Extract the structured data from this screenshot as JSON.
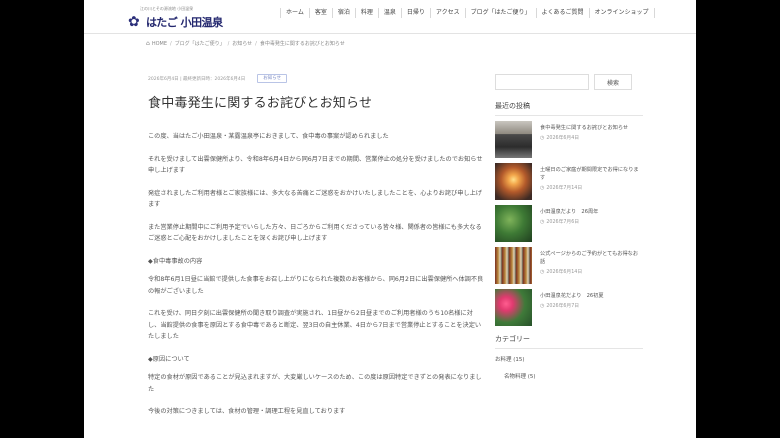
{
  "header": {
    "tagline": "江の川とその源流地 小田温泉",
    "logo_text": "はたご 小田温泉",
    "nav": [
      "ホーム",
      "客室",
      "宿泊",
      "料理",
      "温泉",
      "日帰り",
      "アクセス",
      "ブログ「はたご便り」",
      "よくあるご質問",
      "オンラインショップ"
    ]
  },
  "breadcrumb": [
    "HOME",
    "ブログ「はたご便り」",
    "お知らせ",
    "食中毒発生に関するお詫びとお知らせ"
  ],
  "article": {
    "meta": "2026年6月4日 | 最終更新日時：2026年6月4日",
    "category_badge": "お知らせ",
    "title": "食中毒発生に関するお詫びとお知らせ",
    "paragraphs": [
      "この度、当はたご小田温泉・某露温泉亭におきまして、食中毒の事案が認められました",
      "それを受けまして出雲保健所より、令和8年6月4日から同6月7日までの期間、営業停止の処分を受けましたのでお知らせ申し上げます",
      "発症されましたご利用者様とご家族様には、多大なる苦痛とご迷惑をおかけいたしましたことを、心よりお詫び申し上げます",
      "また営業停止期間中にご利用予定でいらした方々、日ごろからご利用くださっている皆々様、関係者の皆様にも多大なるご迷惑とご心配をおかけしましたことを深くお詫び申し上げます",
      "◆食中毒事故の内容",
      "令和8年6月1日昼に当館で提供した食事をお召し上がりになられた複数のお客様から、同6月2日に出雲保健所へ体調不良の報がございました",
      "これを受け、同日夕刻に出雲保健所の聞き取り調査が実施され、1日昼から2日昼までのご利用者様のうち10名様に対し、当館提供の食事を原因とする食中毒であると断定、翌3日の自主休業、4日から7日まで営業停止とすることを決定いたしました",
      "◆原因について",
      "特定の食材が原因であることが見込まれますが、大変厳しいケースのため、この度は原因特定できずとの発表になりました",
      "今後の対策につきましては、食材の管理・調理工程を見直しております"
    ]
  },
  "sidebar": {
    "search_placeholder": "",
    "search_button": "検索",
    "recent_title": "最近の投稿",
    "posts": [
      {
        "title": "食中毒発生に関するお詫びとお知らせ",
        "date": "2026年6月4日"
      },
      {
        "title": "土曜日のご家庭が期間限定でお得になります",
        "date": "2026年7月14日"
      },
      {
        "title": "小田温泉だより　26周年",
        "date": "2026年7月6日"
      },
      {
        "title": "公式ページからのご予約がとてもお得なお話",
        "date": "2026年6月14日"
      },
      {
        "title": "小田温泉花だより　26初夏",
        "date": "2026年6月7日"
      }
    ],
    "category_title": "カテゴリー",
    "categories": [
      {
        "label": "お料理 (15)"
      },
      {
        "label": "名物料理 (5)"
      }
    ]
  },
  "colors": {
    "logo": "#23276e",
    "badge": "#7a8ac4"
  }
}
